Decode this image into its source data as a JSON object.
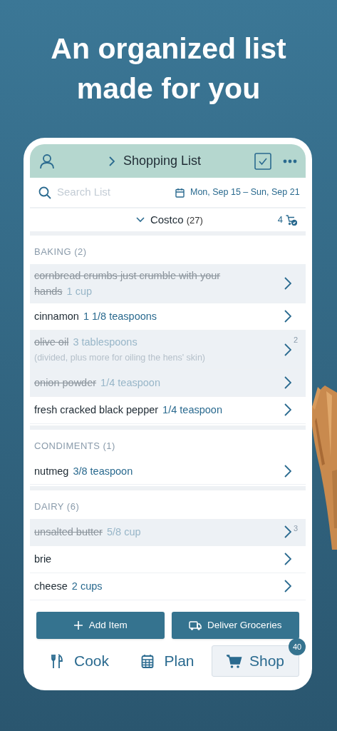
{
  "headline": "An organized list made for you",
  "header": {
    "title": "Shopping List"
  },
  "search": {
    "placeholder": "Search List"
  },
  "date_range": "Mon, Sep 15 – Sun, Sep 21",
  "store": {
    "name": "Costco",
    "count": "(27)",
    "in_cart": "4",
    "expanded": true
  },
  "sections": [
    {
      "title": "BAKING (2)",
      "items": [
        {
          "name": "cornbread crumbs just crumble with your hands",
          "amount": "1 cup",
          "checked": true
        },
        {
          "name": "cinnamon",
          "amount": "1 1/8 teaspoons",
          "checked": false
        },
        {
          "name": "olive oil",
          "amount": "3 tablespoons",
          "note": "(divided, plus more for oiling the hens' skin)",
          "badge": "2",
          "checked": true
        },
        {
          "name": "onion powder",
          "amount": "1/4 teaspoon",
          "checked": true
        },
        {
          "name": "fresh cracked black pepper",
          "amount": "1/4 teaspoon",
          "checked": false
        }
      ]
    },
    {
      "title": "CONDIMENTS (1)",
      "items": [
        {
          "name": "nutmeg",
          "amount": "3/8 teaspoon",
          "checked": false
        }
      ]
    },
    {
      "title": "DAIRY (6)",
      "items": [
        {
          "name": "unsalted butter",
          "amount": "5/8 cup",
          "badge": "3",
          "checked": true
        },
        {
          "name": "brie",
          "checked": false
        },
        {
          "name": "cheese",
          "amount": "2 cups",
          "checked": false
        }
      ]
    }
  ],
  "actions": [
    {
      "kind": "add",
      "label": "Add Item"
    },
    {
      "kind": "deliver",
      "label": "Deliver Groceries"
    }
  ],
  "tabs": [
    {
      "kind": "cook",
      "label": "Cook",
      "selected": false
    },
    {
      "kind": "plan",
      "label": "Plan",
      "selected": false
    },
    {
      "kind": "shop",
      "label": "Shop",
      "selected": true,
      "badge": "40"
    }
  ]
}
